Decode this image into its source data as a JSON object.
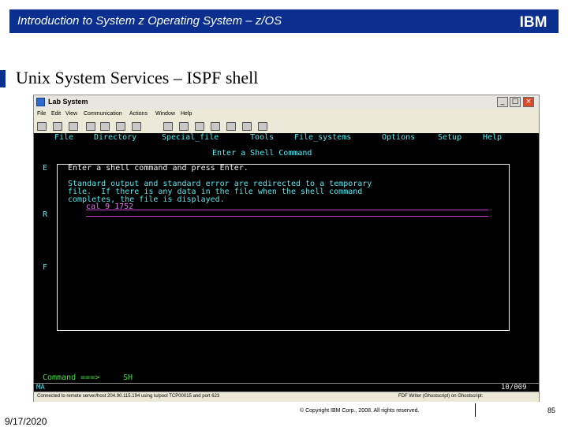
{
  "slide": {
    "header_title": "Introduction to System z Operating System – z/OS",
    "logo_text": "IBM",
    "heading": "Unix System Services – ISPF shell",
    "footer_date": "9/17/2020",
    "footer_copyright": "© Copyright IBM Corp., 2008. All rights reserved.",
    "page_number": "85"
  },
  "window": {
    "title": "Lab System",
    "controls": [
      "_",
      "□",
      "×"
    ],
    "menu": [
      "File",
      "Edit",
      "View",
      "Communication",
      "Actions",
      "Window",
      "Help"
    ],
    "toolbar_icons": [
      "printer-icon",
      "copy-icon",
      "paste-icon",
      "send-icon",
      "receive-icon",
      "display-icon",
      "color-icon",
      "map-icon",
      "record-icon",
      "stop-icon",
      "play-icon",
      "macro-icon",
      "globe-icon",
      "help-icon"
    ]
  },
  "ispf": {
    "menu": [
      "File",
      "Directory",
      "Special_file",
      "Tools",
      "File_systems",
      "Options",
      "Setup",
      "Help"
    ],
    "popup_title": "Enter a Shell Command",
    "left_letters": [
      "E",
      "R",
      "F"
    ],
    "instruction": "Enter a shell command and press Enter.",
    "info_lines": [
      "Standard output and standard error are redirected to a temporary",
      "file.  If there is any data in the file when the shell command",
      "completes, the file is displayed."
    ],
    "input_value": "cal 9 1752",
    "command_prompt": "Command ===>",
    "command_value": "SH",
    "status_left": "MA",
    "status_right": "10/009"
  },
  "statusbar": {
    "connection": "Connected to remote server/host 204.90.115.194 using lu/pool TCP00015 and port 623",
    "printer": "FDF Writer (Ghostscript) on Ghostscript:"
  },
  "colors": {
    "header_bg": "#0a2f8f",
    "terminal_bg": "#000000",
    "terminal_cyan": "#58e8f0",
    "terminal_magenta": "#e070e0",
    "terminal_green": "#40e040"
  }
}
